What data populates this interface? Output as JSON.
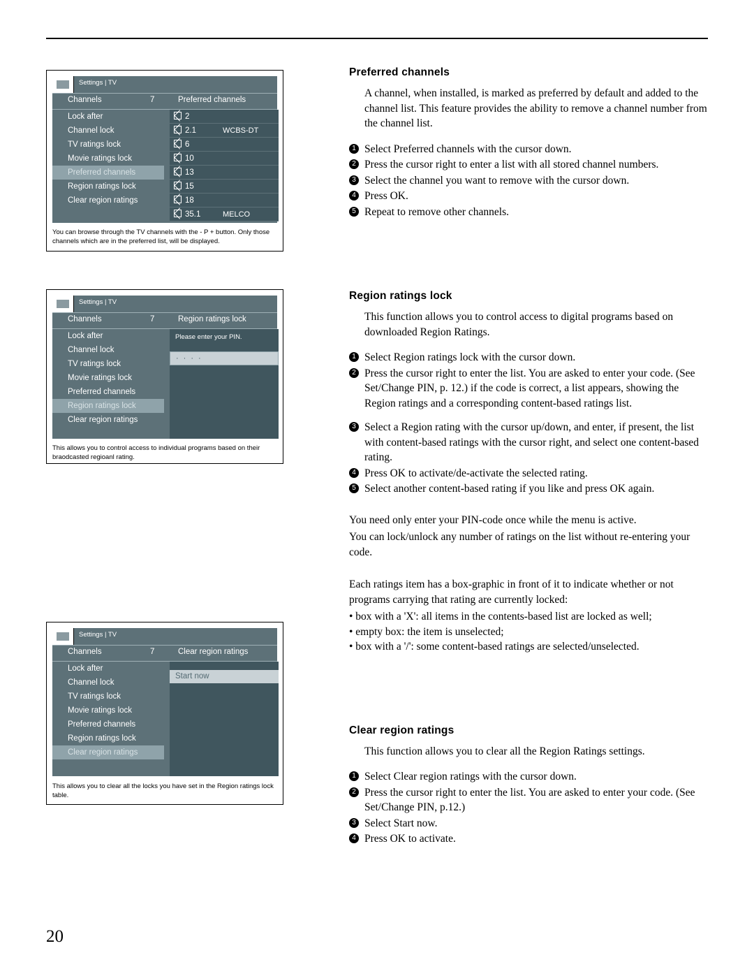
{
  "page": {
    "number": "20"
  },
  "figures": [
    {
      "id": "fig-preferred-channels",
      "breadcrumb": "Settings | TV",
      "header": {
        "left": "Channels",
        "number": "7",
        "right": "Preferred channels"
      },
      "menu": [
        "Lock after",
        "Channel lock",
        "TV ratings lock",
        "Movie ratings lock",
        "Preferred channels",
        "Region ratings lock",
        "Clear region ratings"
      ],
      "selected_menu_index": 4,
      "channels": [
        {
          "number": "2",
          "name": ""
        },
        {
          "number": "2.1",
          "name": "WCBS-DT"
        },
        {
          "number": "6",
          "name": ""
        },
        {
          "number": "10",
          "name": ""
        },
        {
          "number": "13",
          "name": ""
        },
        {
          "number": "15",
          "name": ""
        },
        {
          "number": "18",
          "name": ""
        },
        {
          "number": "35.1",
          "name": "MELCO"
        }
      ],
      "caption": "You can browse through the TV channels with the - P + button. Only those channels which are in the preferred list, will be displayed."
    },
    {
      "id": "fig-region-ratings-lock",
      "breadcrumb": "Settings | TV",
      "header": {
        "left": "Channels",
        "number": "7",
        "right": "Region ratings lock"
      },
      "menu": [
        "Lock after",
        "Channel lock",
        "TV ratings lock",
        "Movie ratings lock",
        "Preferred channels",
        "Region ratings lock",
        "Clear region ratings"
      ],
      "selected_menu_index": 5,
      "pin_prompt": "Please enter your PIN.",
      "pin_value": "····",
      "caption": "This allows you to control access to individual programs based on their braodcasted regioanl rating."
    },
    {
      "id": "fig-clear-region-ratings",
      "breadcrumb": "Settings | TV",
      "header": {
        "left": "Channels",
        "number": "7",
        "right": "Clear region ratings"
      },
      "menu": [
        "Lock after",
        "Channel lock",
        "TV ratings lock",
        "Movie ratings lock",
        "Preferred channels",
        "Region ratings lock",
        "Clear region ratings"
      ],
      "selected_menu_index": 6,
      "start_now": "Start now",
      "caption": "This allows you to clear all the locks you have set in the Region ratings lock table."
    }
  ],
  "sections": {
    "preferred_channels": {
      "title": "Preferred channels",
      "intro": "A channel, when installed, is marked as preferred by default and added to the channel list. This feature provides the ability to remove a channel number from the channel list.",
      "steps": [
        "Select Preferred channels with the cursor down.",
        "Press the cursor right to enter a list with all stored channel numbers.",
        "Select the channel you want to remove with the cursor down.",
        "Press OK.",
        "Repeat to remove other channels."
      ]
    },
    "region_ratings_lock": {
      "title": "Region ratings lock",
      "intro": "This function allows you to control access to digital programs based on downloaded Region Ratings.",
      "steps": [
        "Select Region ratings lock with the cursor down.",
        "Press the cursor right to enter the list. You are asked to enter your code. (See Set/Change PIN, p. 12.) if the code is correct, a list appears, showing the Region ratings and a corresponding content-based ratings list.",
        "Select a Region rating with the cursor up/down, and enter, if present, the list with content-based ratings with the cursor right, and select one content-based rating.",
        "Press OK to activate/de-activate the selected rating.",
        "Select another content-based rating if you like and press OK again."
      ],
      "notes": [
        "You need only enter your PIN-code once while the menu is active.",
        "You can lock/unlock any number of ratings on the list without re-entering your code.",
        "Each ratings item has a box-graphic in front of it to indicate whether or not programs carrying that rating are currently locked:"
      ],
      "bullets": [
        "• box with a 'X': all items in the contents-based list are locked as well;",
        "• empty box: the item is unselected;",
        "• box with a '/': some content-based ratings are selected/unselected."
      ]
    },
    "clear_region_ratings": {
      "title": "Clear region ratings",
      "intro": "This function allows you to clear all the Region Ratings settings.",
      "steps": [
        "Select Clear region ratings with the cursor down.",
        "Press the cursor right to enter the list. You are asked to enter your code. (See Set/Change PIN, p.12.)",
        "Select Start now.",
        "Press OK to activate."
      ]
    }
  }
}
